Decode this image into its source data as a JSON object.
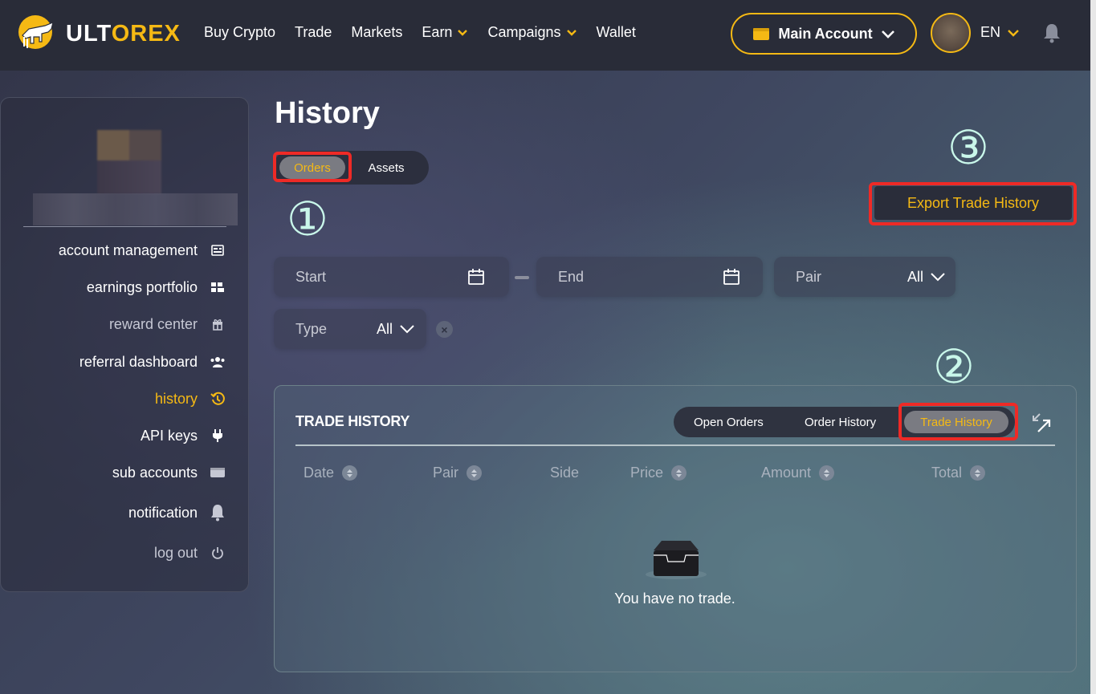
{
  "brand": {
    "part1": "ULT",
    "part2": "OREX"
  },
  "nav": {
    "items": [
      "Buy Crypto",
      "Trade",
      "Markets",
      "Earn",
      "Campaigns",
      "Wallet"
    ],
    "account_label": "Main Account",
    "language": "EN"
  },
  "sidebar": {
    "items": [
      {
        "label": "account management",
        "icon": "id-card-icon"
      },
      {
        "label": "earnings portfolio",
        "icon": "blocks-icon"
      },
      {
        "label": "reward center",
        "icon": "gift-icon"
      },
      {
        "label": "referral dashboard",
        "icon": "users-icon"
      },
      {
        "label": "history",
        "icon": "history-icon"
      },
      {
        "label": "API keys",
        "icon": "plug-icon"
      },
      {
        "label": "sub accounts",
        "icon": "wallet-icon"
      },
      {
        "label": "notification",
        "icon": "bell-icon"
      },
      {
        "label": "log out",
        "icon": "power-icon"
      }
    ],
    "active": "history"
  },
  "page": {
    "title": "History",
    "tabs": [
      "Orders",
      "Assets"
    ],
    "active_tab": "Orders",
    "export_label": "Export Trade History",
    "annotations": [
      "①",
      "②",
      "③"
    ]
  },
  "filters": {
    "start_label": "Start",
    "end_label": "End",
    "pair_label": "Pair",
    "pair_value": "All",
    "type_label": "Type",
    "type_value": "All"
  },
  "trade_card": {
    "title": "TRADE HISTORY",
    "tabs": [
      "Open Orders",
      "Order History",
      "Trade History"
    ],
    "active_tab": "Trade History",
    "columns": [
      "Date",
      "Pair",
      "Side",
      "Price",
      "Amount",
      "Total"
    ],
    "empty_text": "You have no trade."
  },
  "colors": {
    "accent": "#f5b914",
    "highlight": "#ee2a26",
    "annotation": "#c9f7ea"
  }
}
